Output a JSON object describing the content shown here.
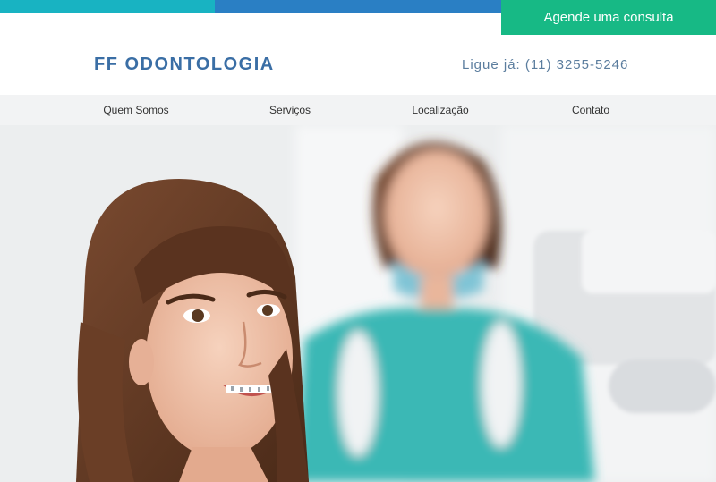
{
  "header": {
    "cta_label": "Agende uma consulta",
    "logo": "FF ODONTOLOGIA",
    "phone": "Ligue já: (11) 3255-5246"
  },
  "nav": {
    "items": [
      {
        "label": "Quem Somos"
      },
      {
        "label": "Serviços"
      },
      {
        "label": "Localização"
      },
      {
        "label": "Contato"
      }
    ]
  },
  "colors": {
    "bar_teal": "#18b3c2",
    "bar_blue": "#2a7fc4",
    "cta_green": "#17b985",
    "logo_blue": "#3a6ea5"
  }
}
